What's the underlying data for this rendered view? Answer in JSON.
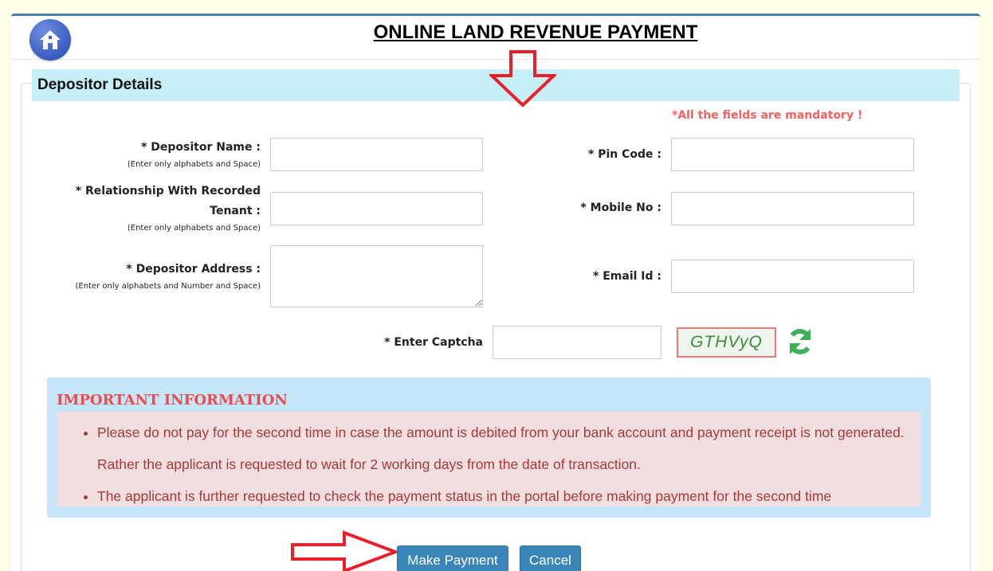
{
  "page": {
    "title": "ONLINE LAND REVENUE PAYMENT"
  },
  "section": {
    "title": "Depositor Details",
    "mandatory_note": "*All the fields are mandatory !"
  },
  "fields": {
    "depositor_name": {
      "label": "* Depositor Name :",
      "hint": "(Enter only alphabets and Space)",
      "value": ""
    },
    "relationship": {
      "label_line1": "* Relationship With Recorded",
      "label_line2": "Tenant :",
      "hint": "(Enter only alphabets  and Space)",
      "value": ""
    },
    "depositor_address": {
      "label": "* Depositor Address :",
      "hint": "(Enter only alphabets and Number and Space)",
      "value": ""
    },
    "pin_code": {
      "label": "* Pin Code :",
      "value": ""
    },
    "mobile_no": {
      "label": "* Mobile No :",
      "value": ""
    },
    "email_id": {
      "label": "* Email Id :",
      "value": ""
    },
    "captcha": {
      "label": "* Enter Captcha",
      "value": "",
      "image_text": "GTHVyQ"
    }
  },
  "info": {
    "title": "IMPORTANT INFORMATION",
    "items": [
      "Please do not pay for the second time in case the amount is debited from your bank account and payment receipt is not generated. Rather the applicant is requested to wait for 2 working days from the date of transaction.",
      "The applicant is further requested to check the payment status in the portal before making payment for the second time"
    ]
  },
  "buttons": {
    "make_payment": "Make Payment",
    "cancel": "Cancel"
  },
  "icons": {
    "home": "home-icon",
    "refresh": "refresh-icon",
    "annotation_arrow_down": "arrow-down-icon",
    "annotation_arrow_right": "arrow-right-icon"
  },
  "colors": {
    "accent": "#3b86b8",
    "section_bg": "#c5eef6",
    "mandatory": "#f26060",
    "info_title": "#e84c4c",
    "info_text": "#a53a3a",
    "annotation_arrow": "#e8202a"
  }
}
